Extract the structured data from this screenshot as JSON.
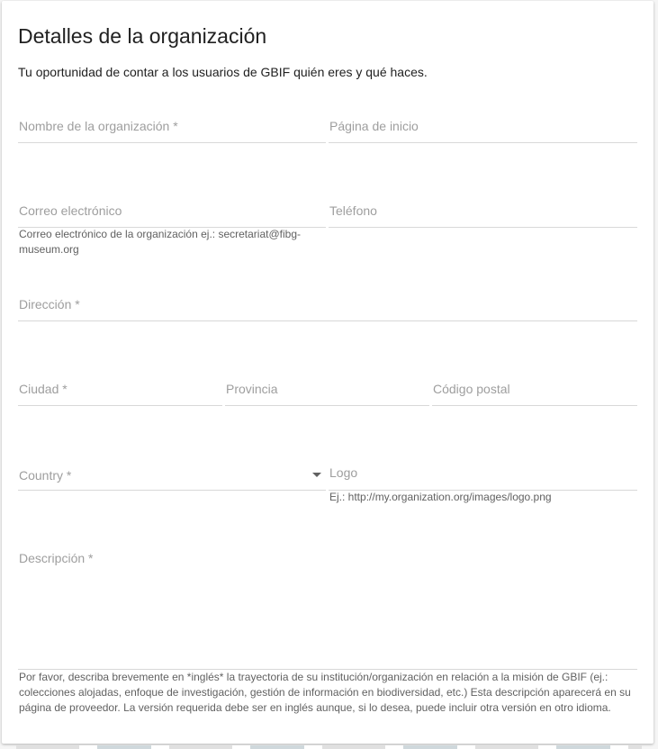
{
  "section": {
    "title": "Detalles de la organización",
    "subtitle": "Tu oportunidad de contar a los usuarios de GBIF quién eres y qué haces."
  },
  "fields": {
    "org_name": {
      "placeholder": "Nombre de la organización *"
    },
    "homepage": {
      "placeholder": "Página de inicio"
    },
    "email": {
      "placeholder": "Correo electrónico",
      "hint_line1": "Correo electrónico de la organización ej.: secretariat@fibg-",
      "hint_line2": "museum.org"
    },
    "phone": {
      "placeholder": "Teléfono"
    },
    "address": {
      "placeholder": "Dirección *"
    },
    "city": {
      "placeholder": "Ciudad *"
    },
    "province": {
      "placeholder": "Provincia"
    },
    "postal_code": {
      "placeholder": "Código postal"
    },
    "country": {
      "placeholder": "Country *"
    },
    "logo": {
      "placeholder": "Logo",
      "hint": "Ej.: http://my.organization.org/images/logo.png"
    },
    "description": {
      "placeholder": "Descripción *",
      "hint_line1": "Por favor, describa brevemente en *inglés* la trayectoria de su institución/organización en relación a la misión de GBIF (ej.:",
      "hint_line2": "colecciones alojadas, enfoque de investigación, gestión de información en biodiversidad, etc.) Esta descripción aparecerá en su",
      "hint_line3": "página de proveedor. La versión requerida debe ser en inglés aunque, si lo desea, puede incluir otra versión en otro idioma."
    }
  }
}
